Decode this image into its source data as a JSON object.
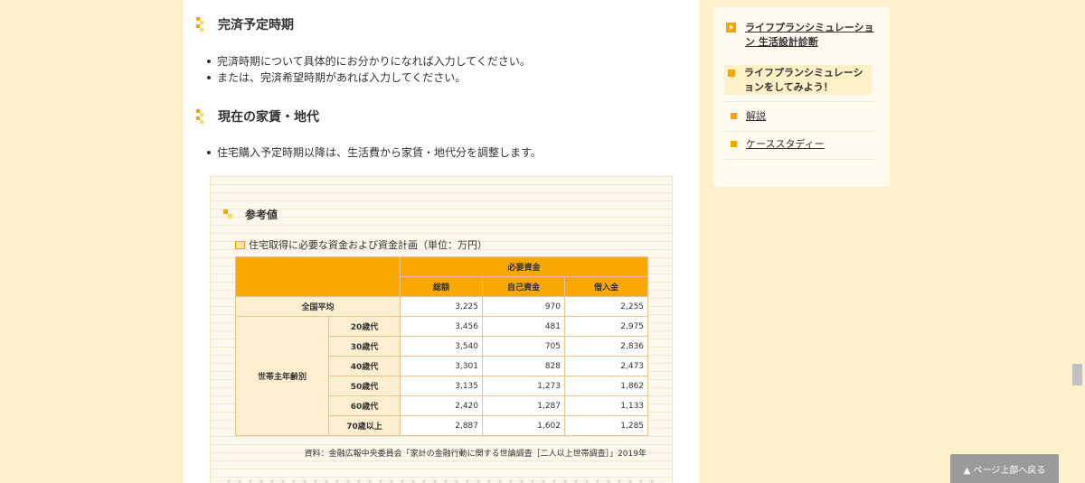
{
  "sections": {
    "completion": {
      "title": "完済予定時期",
      "bullets": [
        "完済時期について具体的にお分かりになれば入力してください。",
        "または、完済希望時期があれば入力してください。"
      ]
    },
    "rent": {
      "title": "現在の家賃・地代",
      "bullets": [
        "住宅購入予定時期以降は、生活費から家賃・地代分を調整します。"
      ]
    }
  },
  "reference": {
    "heading": "参考値",
    "caption": "住宅取得に必要な資金および資金計画（単位：万円）",
    "table": {
      "group_header": "必要資金",
      "columns": [
        "総額",
        "自己資金",
        "借入金"
      ],
      "national": {
        "label": "全国平均",
        "values": [
          "3,225",
          "970",
          "2,255"
        ]
      },
      "group_label": "世帯主年齢別",
      "rows": [
        {
          "label": "20歳代",
          "values": [
            "3,456",
            "481",
            "2,975"
          ]
        },
        {
          "label": "30歳代",
          "values": [
            "3,540",
            "705",
            "2,836"
          ]
        },
        {
          "label": "40歳代",
          "values": [
            "3,301",
            "828",
            "2,473"
          ]
        },
        {
          "label": "50歳代",
          "values": [
            "3,135",
            "1,273",
            "1,862"
          ]
        },
        {
          "label": "60歳代",
          "values": [
            "2,420",
            "1,287",
            "1,133"
          ]
        },
        {
          "label": "70歳以上",
          "values": [
            "2,887",
            "1,602",
            "1,285"
          ]
        }
      ]
    },
    "source": "資料：金融広報中央委員会「家計の金融行動に関する世論調査［二人以上世帯調査］」2019年"
  },
  "sidebar": {
    "title_link": "ライフプランシミュレーション 生活設計診断",
    "active_item": "ライフプランシミュレーションをしてみよう！",
    "items": [
      "解説",
      "ケーススタディー"
    ]
  },
  "back_to_top": "▲ ページ上部へ戻る",
  "colors": {
    "accent": "#f9a800",
    "page_bg": "#fff0cc",
    "pale": "#fdeed0"
  }
}
